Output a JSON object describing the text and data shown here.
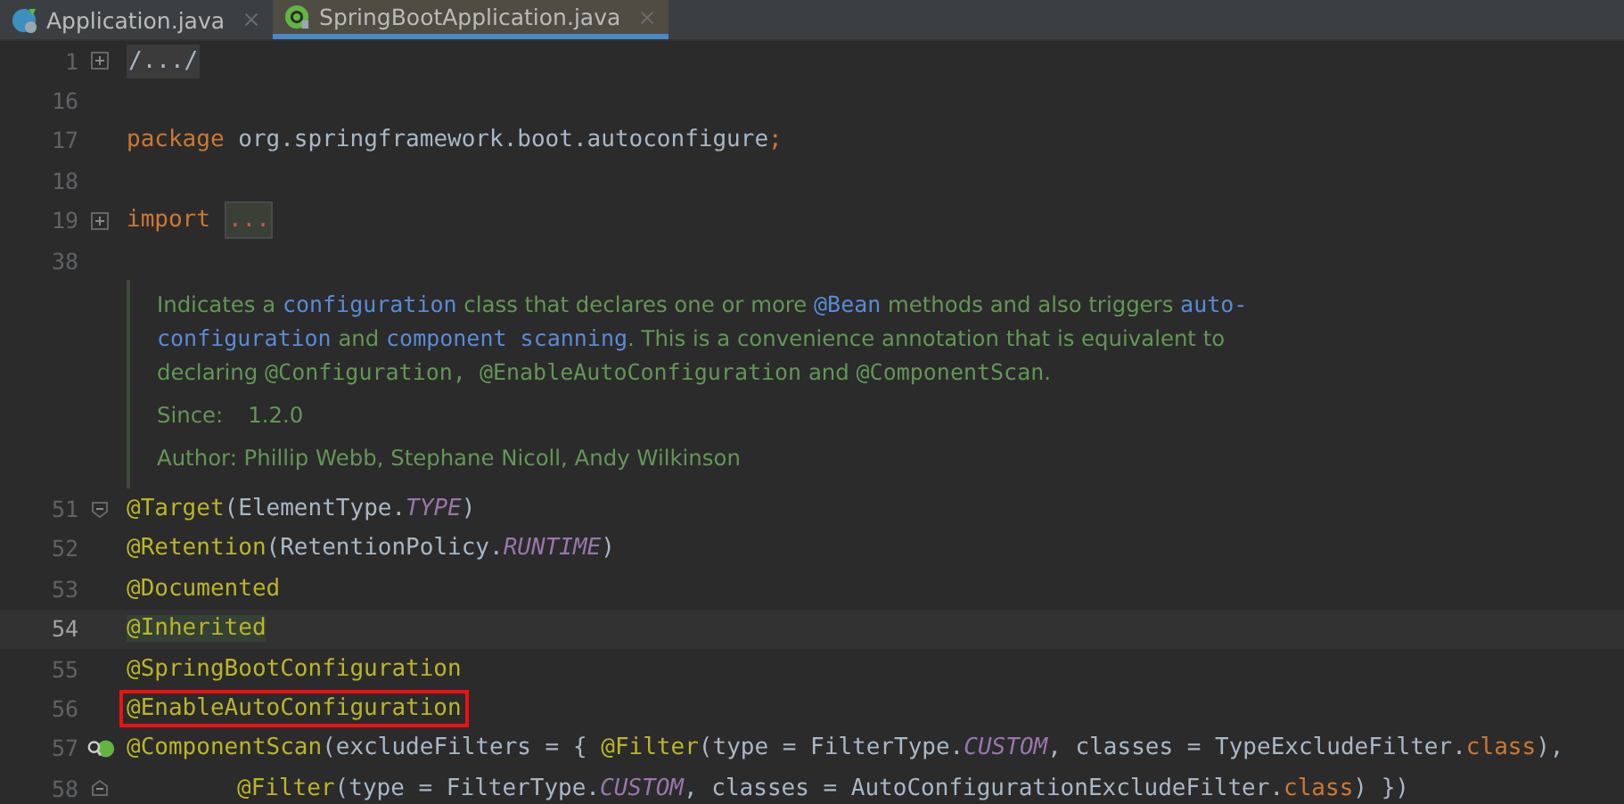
{
  "tabs": [
    {
      "label": "Application.java",
      "selected": false
    },
    {
      "label": "SpringBootApplication.java",
      "selected": true
    }
  ],
  "lines_top": [
    {
      "number": "1",
      "kind": "folded",
      "tokens": [
        {
          "text": "/.../",
          "kind": "fold"
        }
      ]
    },
    {
      "number": "16",
      "kind": "plain"
    },
    {
      "number": "17",
      "kind": "plain",
      "tokens": [
        {
          "text": "package",
          "kind": "keyword"
        },
        {
          "text": " org.springframework.boot.autoconfigure",
          "kind": "plain"
        },
        {
          "text": ";",
          "kind": "keyword"
        }
      ]
    },
    {
      "number": "18",
      "kind": "plain"
    },
    {
      "number": "19",
      "kind": "folded",
      "tokens": [
        {
          "text": "import",
          "kind": "keyword"
        },
        {
          "text": "...",
          "kind": "fold_red"
        }
      ]
    },
    {
      "number": "38",
      "kind": "plain"
    }
  ],
  "doc": {
    "lines": [
      [
        {
          "text": "Indicates a ",
          "kind": "text"
        },
        {
          "text": "configuration",
          "kind": "code"
        },
        {
          "text": " class that declares one or more ",
          "kind": "text"
        },
        {
          "text": "@Bean",
          "kind": "code"
        },
        {
          "text": " methods and also triggers ",
          "kind": "text"
        },
        {
          "text": "auto-",
          "kind": "code"
        }
      ],
      [
        {
          "text": "configuration",
          "kind": "code"
        },
        {
          "text": " and ",
          "kind": "text"
        },
        {
          "text": "component scanning",
          "kind": "code"
        },
        {
          "text": ". This is a convenience annotation that is equivalent to",
          "kind": "text"
        }
      ],
      [
        {
          "text": "declaring ",
          "kind": "text"
        },
        {
          "text": "@Configuration, ",
          "kind": "mono"
        },
        {
          "text": "@EnableAutoConfiguration",
          "kind": "mono"
        },
        {
          "text": " and ",
          "kind": "text"
        },
        {
          "text": "@ComponentScan",
          "kind": "mono"
        },
        {
          "text": ".",
          "kind": "text"
        }
      ]
    ],
    "since_label": "Since:",
    "since_value": "1.2.0",
    "author": "Author: Phillip Webb, Stephane Nicoll, Andy Wilkinson"
  },
  "lines_bottom": [
    {
      "number": "51",
      "kind": "fold_start",
      "current": false,
      "indented": false,
      "tokens": [
        {
          "text": "@Target",
          "kind": "annotation"
        },
        {
          "text": "(ElementType.",
          "kind": "plain"
        },
        {
          "text": "TYPE",
          "kind": "constant"
        },
        {
          "text": ")",
          "kind": "plain"
        }
      ]
    },
    {
      "number": "52",
      "kind": "plain",
      "current": false,
      "indented": false,
      "tokens": [
        {
          "text": "@Retention",
          "kind": "annotation"
        },
        {
          "text": "(RetentionPolicy.",
          "kind": "plain"
        },
        {
          "text": "RUNTIME",
          "kind": "constant"
        },
        {
          "text": ")",
          "kind": "plain"
        }
      ]
    },
    {
      "number": "53",
      "kind": "plain",
      "current": false,
      "indented": false,
      "tokens": [
        {
          "text": "@Documented",
          "kind": "annotation"
        }
      ]
    },
    {
      "number": "54",
      "kind": "plain",
      "current": true,
      "indented": false,
      "tokens": [
        {
          "text": "@Inherited",
          "kind": "annotation_hl"
        }
      ]
    },
    {
      "number": "55",
      "kind": "plain",
      "current": false,
      "indented": false,
      "tokens": [
        {
          "text": "@SpringBootConfiguration",
          "kind": "annotation"
        }
      ]
    },
    {
      "number": "56",
      "kind": "plain",
      "current": false,
      "indented": false,
      "boxed": true,
      "tokens": [
        {
          "text": "@EnableAutoConfiguration",
          "kind": "annotation"
        }
      ]
    },
    {
      "number": "57",
      "kind": "bean",
      "current": false,
      "indented": false,
      "tokens": [
        {
          "text": "@ComponentScan",
          "kind": "annotation"
        },
        {
          "text": "(excludeFilters = { ",
          "kind": "plain"
        },
        {
          "text": "@Filter",
          "kind": "annotation"
        },
        {
          "text": "(type = FilterType.",
          "kind": "plain"
        },
        {
          "text": "CUSTOM",
          "kind": "constant"
        },
        {
          "text": ", classes = TypeExcludeFilter.",
          "kind": "plain"
        },
        {
          "text": "class",
          "kind": "keyword"
        },
        {
          "text": "),",
          "kind": "plain"
        }
      ]
    },
    {
      "number": "58",
      "kind": "fold_end",
      "current": false,
      "indented": true,
      "tokens": [
        {
          "text": "@Filter",
          "kind": "annotation"
        },
        {
          "text": "(type = FilterType.",
          "kind": "plain"
        },
        {
          "text": "CUSTOM",
          "kind": "constant"
        },
        {
          "text": ", classes = AutoConfigurationExcludeFilter.",
          "kind": "plain"
        },
        {
          "text": "class",
          "kind": "keyword"
        },
        {
          "text": ") })",
          "kind": "plain"
        }
      ]
    }
  ]
}
